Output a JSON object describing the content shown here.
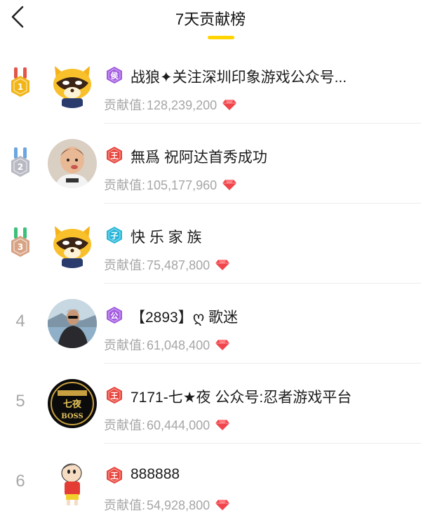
{
  "header": {
    "title": "7天贡献榜"
  },
  "contribution_label": "贡献值:",
  "rows": [
    {
      "rank": "1",
      "badge_char": "侯",
      "badge_color": "#a25be0",
      "name": "战狼✦关注深圳印象游戏公众号...",
      "value": "128,239,200",
      "avatar": "raccoon-avatar"
    },
    {
      "rank": "2",
      "badge_char": "王",
      "badge_color": "#e8453c",
      "name": "無爲 祝阿达首秀成功",
      "value": "105,177,960",
      "avatar": "child-photo-avatar"
    },
    {
      "rank": "3",
      "badge_char": "子",
      "badge_color": "#27b6d8",
      "name": "快 乐 家 族",
      "value": "75,487,800",
      "avatar": "raccoon-avatar"
    },
    {
      "rank": "4",
      "badge_char": "公",
      "badge_color": "#a25be0",
      "name": "【2893】ღ 歌迷",
      "value": "61,048,400",
      "avatar": "man-photo-avatar"
    },
    {
      "rank": "5",
      "badge_char": "王",
      "badge_color": "#e8453c",
      "name": "7171-七★夜 公众号:忍者游戏平台",
      "value": "60,444,000",
      "avatar": "boss-logo-avatar"
    },
    {
      "rank": "6",
      "badge_char": "王",
      "badge_color": "#e8453c",
      "name": "888888",
      "value": "54,928,800",
      "avatar": "cartoon-boy-avatar"
    }
  ],
  "colors": {
    "accent": "#ffd400",
    "gold": "#f2b516",
    "silver": "#b8b9c2",
    "bronze": "#d8a385",
    "gem": "#f0454a"
  }
}
